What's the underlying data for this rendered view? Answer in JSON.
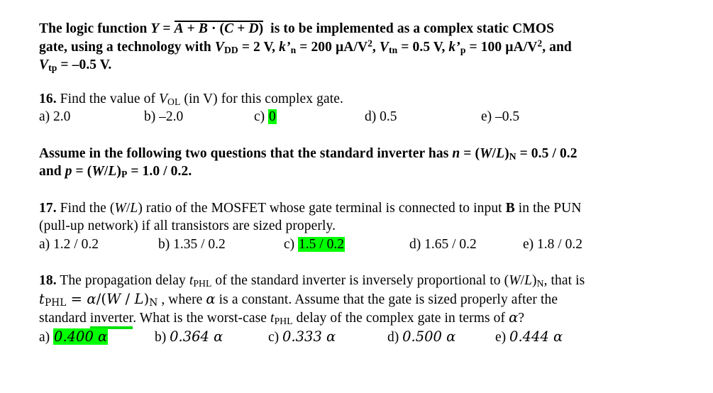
{
  "document": {
    "type": "exam-question-sheet",
    "highlight_color": "#00ff00",
    "text_color": "#000000",
    "background_color": "#ffffff"
  },
  "preamble": {
    "line1_a": "The logic function ",
    "line1_var": "Y",
    "line1_eq": "=",
    "line1_expr_a": "A",
    "line1_expr_plus": "+",
    "line1_expr_b": "B",
    "line1_expr_dot": "·",
    "line1_expr_paren_open": "(",
    "line1_expr_c": "C",
    "line1_expr_plus2": "+",
    "line1_expr_d": "D",
    "line1_expr_paren_close": ")",
    "line1_b": "is to be implemented as a complex static CMOS",
    "line2_a": "gate, using a technology with ",
    "vdd_sym": "V",
    "vdd_sub": "DD",
    "vdd_val": " = 2 V, ",
    "kn_sym": "k’",
    "kn_sub": "n",
    "kn_val": " = 200 µA/V",
    "kn_exp": "2",
    "vtn_sep": ", ",
    "vtn_sym": "V",
    "vtn_sub": "tn",
    "vtn_val": " = 0.5 V, ",
    "kp_sym": "k’",
    "kp_sub": "p",
    "kp_val": " = 100 µA/V",
    "kp_exp": "2",
    "line2_end": ", and",
    "vtp_sym": "V",
    "vtp_sub": "tp",
    "vtp_val": " = –0.5 V."
  },
  "q16": {
    "number": "16.",
    "text_a": " Find the value of ",
    "vol_sym": "V",
    "vol_sub": "OL",
    "text_b": " (in V) for this complex gate.",
    "options": [
      {
        "letter": "a)",
        "value": "2.0",
        "highlighted": false
      },
      {
        "letter": "b)",
        "value": "–2.0",
        "highlighted": false
      },
      {
        "letter": "c)",
        "value": "0",
        "highlighted": true
      },
      {
        "letter": "d)",
        "value": "0.5",
        "highlighted": false
      },
      {
        "letter": "e)",
        "value": "–0.5",
        "highlighted": false
      }
    ]
  },
  "assume_note": {
    "line1_a": "Assume in the following two questions that the standard inverter has ",
    "n_sym": "n",
    "n_eq": " = (",
    "wl_w": "W",
    "wl_slash": "/",
    "wl_l": "L",
    "wl_close": ")",
    "n_sub": "N",
    "n_val": " = 0.5 / 0.2",
    "line2_a": "and ",
    "p_sym": "p",
    "p_eq": " = (",
    "p_sub": "P",
    "p_val": " = 1.0 / 0.2."
  },
  "q17": {
    "number": "17.",
    "text_a": " Find the (",
    "wl_w": "W",
    "wl_slash": "/",
    "wl_l": "L",
    "text_b": ") ratio of the MOSFET whose gate terminal is connected to input ",
    "input_label": "B",
    "text_c": " in the PUN",
    "line2": "(pull-up network) if all transistors are sized properly.",
    "options": [
      {
        "letter": "a)",
        "value": "1.2 / 0.2",
        "highlighted": false
      },
      {
        "letter": "b)",
        "value": "1.35 / 0.2",
        "highlighted": false
      },
      {
        "letter": "c)",
        "value": "1.5 / 0.2",
        "highlighted": true
      },
      {
        "letter": "d)",
        "value": "1.65 / 0.2",
        "highlighted": false
      },
      {
        "letter": "e)",
        "value": "1.8 / 0.2",
        "highlighted": false
      }
    ]
  },
  "q18": {
    "number": "18.",
    "text_a": " The propagation delay ",
    "tphl_t": "t",
    "tphl_sub": "PHL",
    "text_b": " of the standard inverter is inversely proportional to (",
    "wl_w": "W",
    "wl_slash": "/",
    "wl_l": "L",
    "wl_close": ")",
    "wl_sub": "N",
    "text_c": ", that is",
    "formula_t": "t",
    "formula_sub": "PHL",
    "formula_eq": " = ",
    "formula_alpha": "α",
    "formula_div": "/(",
    "formula_w": "W",
    "formula_slash": " / ",
    "formula_l": "L",
    "formula_close": ")",
    "formula_n": "N",
    "text_d": " , where ",
    "alpha": "α",
    "text_e": " is a constant. Assume that the gate is sized properly after the",
    "line3_a": "standard ",
    "line3_underlined": "inverter",
    "line3_b": ". What is the worst-case ",
    "line3_tphl_t": "t",
    "line3_tphl_sub": "PHL",
    "line3_c": " delay of the complex gate in terms of ",
    "line3_alpha": "α",
    "line3_d": "?",
    "options": [
      {
        "letter": "a)",
        "value": "0.400 α",
        "highlighted": true
      },
      {
        "letter": "b)",
        "value": "0.364 α",
        "highlighted": false
      },
      {
        "letter": "c)",
        "value": "0.333 α",
        "highlighted": false
      },
      {
        "letter": "d)",
        "value": "0.500 α",
        "highlighted": false
      },
      {
        "letter": "e)",
        "value": "0.444 α",
        "highlighted": false
      }
    ]
  }
}
